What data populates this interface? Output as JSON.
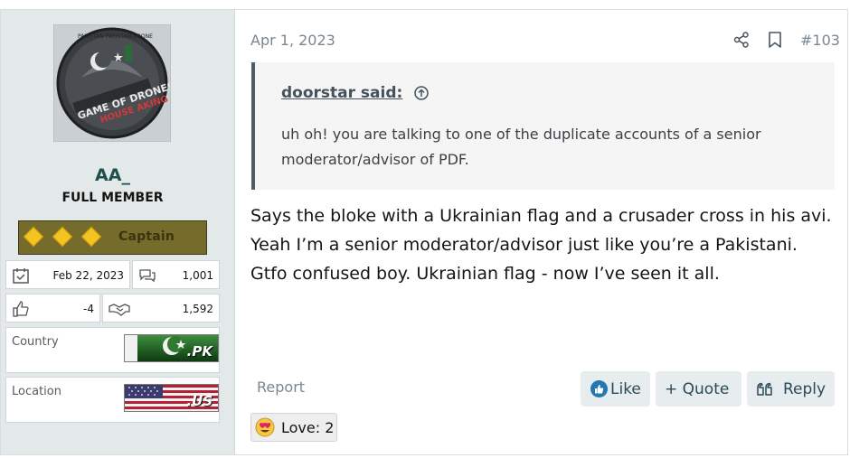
{
  "user": {
    "name": "AA_",
    "title": "FULL MEMBER",
    "rank": "Captain",
    "avatar_text": {
      "top": "PAKISTAN PAKISTAN DRONE",
      "main": "GAME OF DRONES",
      "sub": "HOUSE AKING"
    },
    "joined": "Feb 22, 2023",
    "messages": "1,001",
    "reaction_score": "-4",
    "points": "1,592",
    "country_label": "Country",
    "country_code": ".PK",
    "location_label": "Location",
    "location_code": ".US"
  },
  "message": {
    "date": "Apr 1, 2023",
    "number": "#103",
    "quote_author": "doorstar said:",
    "quote_text": "uh oh! you are talking to one of the duplicate accounts of a senior moderator/advisor of PDF.",
    "body": "Says the bloke with a Ukrainian flag and a crusader cross in his avi. Yeah I’m a senior moderator/advisor just like you’re a Pakistani. Gtfo confused boy. Ukrainian flag - now I’ve seen it all."
  },
  "actions": {
    "report": "Report",
    "like": "Like",
    "quote": "+ Quote",
    "reply": "Reply"
  },
  "reactions": {
    "summary": "Love: 2"
  },
  "colors": {
    "panel_bg": "#e3e9e8",
    "username": "#1e4f4c",
    "button_bg": "#e7ecee",
    "accent_blue": "#2577b1"
  }
}
